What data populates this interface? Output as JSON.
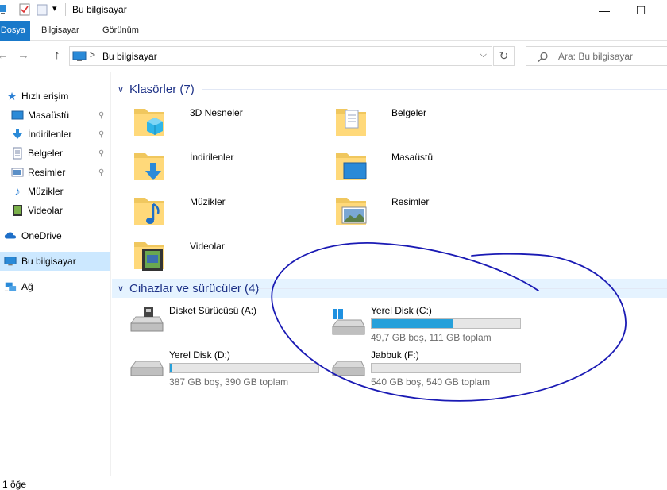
{
  "window": {
    "title": "Bu bilgisayar",
    "minimize_glyph": "—",
    "maximize_glyph": "☐",
    "quick_access_dropdown_glyph": "▾"
  },
  "ribbon": {
    "tabs": [
      {
        "label": "Dosya"
      },
      {
        "label": "Bilgisayar"
      },
      {
        "label": "Görünüm"
      }
    ]
  },
  "addressbar": {
    "back_glyph": "←",
    "forward_glyph": "→",
    "up_glyph": "↑",
    "separator": ">",
    "crumb": "Bu bilgisayar",
    "dropdown_glyph": "⌵",
    "refresh_glyph": "↻"
  },
  "search": {
    "placeholder": "Ara: Bu bilgisayar",
    "icon": "search-icon"
  },
  "navpane": {
    "items": [
      {
        "label": "Hızlı erişim",
        "icon": "star-icon"
      },
      {
        "label": "Masaüstü",
        "icon": "desktop-icon",
        "pinned": true
      },
      {
        "label": "İndirilenler",
        "icon": "download-icon",
        "pinned": true
      },
      {
        "label": "Belgeler",
        "icon": "document-icon",
        "pinned": true
      },
      {
        "label": "Resimler",
        "icon": "pictures-icon",
        "pinned": true
      },
      {
        "label": "Müzikler",
        "icon": "music-icon"
      },
      {
        "label": "Videolar",
        "icon": "video-icon"
      },
      {
        "label": "OneDrive",
        "icon": "cloud-icon"
      },
      {
        "label": "Bu bilgisayar",
        "icon": "computer-icon",
        "selected": true
      },
      {
        "label": "Ağ",
        "icon": "network-icon"
      }
    ],
    "pin_glyph": "📌"
  },
  "folders_group": {
    "chevron": "∨",
    "title": "Klasörler (7)",
    "items": [
      {
        "label": "3D Nesneler",
        "icon": "3d-objects-folder-icon"
      },
      {
        "label": "Belgeler",
        "icon": "documents-folder-icon"
      },
      {
        "label": "İndirilenler",
        "icon": "downloads-folder-icon"
      },
      {
        "label": "Masaüstü",
        "icon": "desktop-folder-icon"
      },
      {
        "label": "Müzikler",
        "icon": "music-folder-icon"
      },
      {
        "label": "Resimler",
        "icon": "pictures-folder-icon"
      },
      {
        "label": "Videolar",
        "icon": "videos-folder-icon"
      }
    ]
  },
  "drives_group": {
    "chevron": "∨",
    "title": "Cihazlar ve sürücüler (4)",
    "items": [
      {
        "label": "Disket Sürücüsü (A:)",
        "icon": "floppy-drive-icon",
        "has_bar": false
      },
      {
        "label": "Yerel Disk (C:)",
        "icon": "windows-drive-icon",
        "has_bar": true,
        "used_fraction": 0.55,
        "info": "49,7 GB boş, 111 GB toplam"
      },
      {
        "label": "Yerel Disk (D:)",
        "icon": "hard-drive-icon",
        "has_bar": true,
        "used_fraction": 0.01,
        "info": "387 GB boş, 390 GB toplam"
      },
      {
        "label": "Jabbuk (F:)",
        "icon": "hard-drive-icon",
        "has_bar": true,
        "used_fraction": 0.0,
        "info": "540 GB boş, 540 GB toplam"
      }
    ]
  },
  "status": {
    "text": "1 öğe"
  },
  "colors": {
    "accent": "#1979ca",
    "drive_fill": "#26a0da",
    "group_title": "#1e3287",
    "scribble": "#1a1ab4",
    "selection": "#cce8ff"
  }
}
